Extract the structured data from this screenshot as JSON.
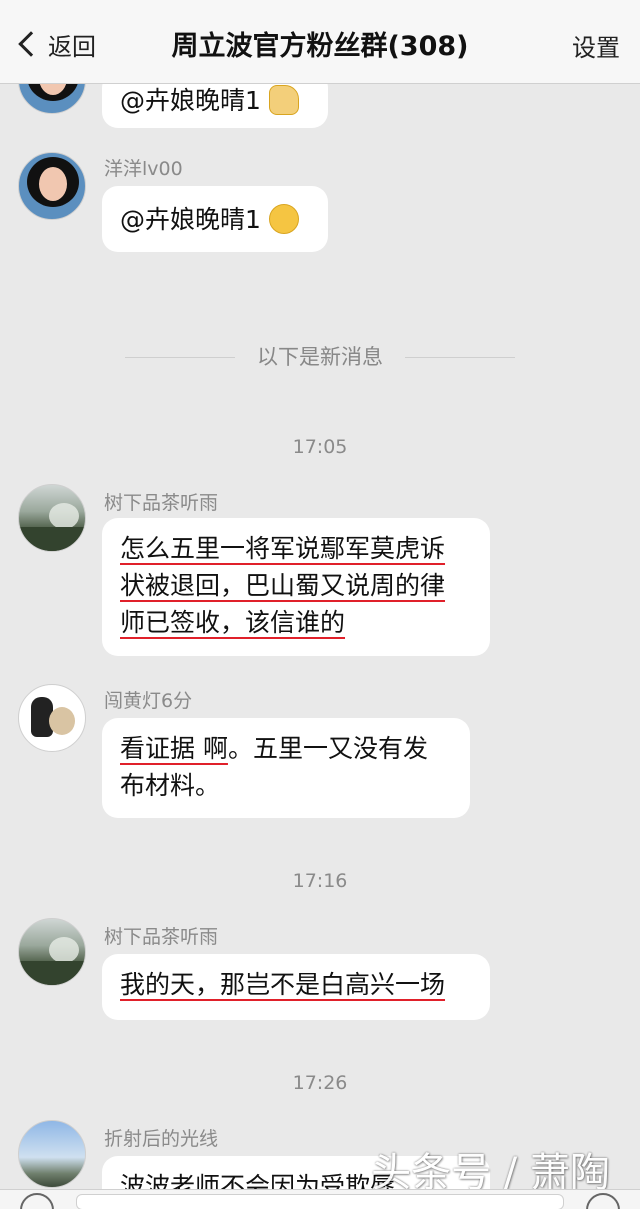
{
  "nav": {
    "back_label": "返回",
    "title": "周立波官方粉丝群(308)",
    "settings_label": "设置"
  },
  "messages": [
    {
      "sender": "",
      "text": "@卉娘晚晴1",
      "emoji": "victory-hand-emoji",
      "avatar": "woman-avatar"
    },
    {
      "sender": "洋洋lv00",
      "text": "@卉娘晚晴1",
      "emoji": "blushing-face-emoji",
      "avatar": "woman-avatar"
    },
    {
      "sender": "树下品茶听雨",
      "lines": [
        "怎么五里一将军说鄢军莫虎诉",
        "状被退回，巴山蜀又说周的律",
        "师已签收，该信谁的"
      ],
      "avatar": "landscape-avatar"
    },
    {
      "sender": "闯黄灯6分",
      "line1_underlined": "看证据 啊",
      "line1_rest": "。五里一又没有发",
      "line2": "布材料。",
      "avatar": "dog-avatar"
    },
    {
      "sender": "树下品茶听雨",
      "text": "我的天，那岂不是白高兴一场",
      "avatar": "landscape-avatar"
    },
    {
      "sender": "折射后的光线",
      "text": "波波老师不会因为受欺辱",
      "avatar": "sky-avatar"
    }
  ],
  "divider_text": "以下是新消息",
  "times": [
    "17:05",
    "17:16",
    "17:26"
  ],
  "watermark": "头条号 / 萧陶",
  "colors": {
    "underline": "#e0202a",
    "background": "#e9e9e9",
    "bubble": "#ffffff"
  }
}
